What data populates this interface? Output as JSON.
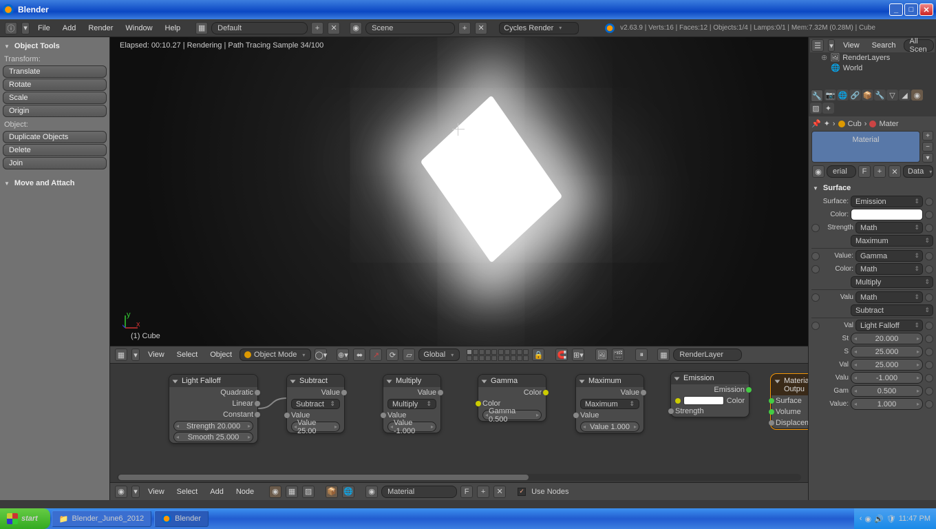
{
  "window": {
    "title": "Blender"
  },
  "top_menu": {
    "items": [
      "File",
      "Add",
      "Render",
      "Window",
      "Help"
    ],
    "layout": "Default",
    "scene": "Scene",
    "engine": "Cycles Render",
    "stats": "v2.63.9 | Verts:16 | Faces:12 | Objects:1/4 | Lamps:0/1 | Mem:7.32M (0.28M) | Cube"
  },
  "left": {
    "panel1": "Object Tools",
    "transform_lbl": "Transform:",
    "transform": [
      "Translate",
      "Rotate",
      "Scale",
      "Origin"
    ],
    "object_lbl": "Object:",
    "object": [
      "Duplicate Objects",
      "Delete",
      "Join"
    ],
    "panel2": "Move and Attach"
  },
  "viewport": {
    "status": "Elapsed: 00:10.27 | Rendering | Path Tracing Sample 34/100",
    "label": "(1) Cube",
    "header": {
      "menus": [
        "View",
        "Select",
        "Object"
      ],
      "mode": "Object Mode",
      "orient": "Global",
      "layer": "RenderLayer"
    }
  },
  "nodes": {
    "falloff": {
      "title": "Light Falloff",
      "out1": "Quadratic",
      "out2": "Linear",
      "out3": "Constant",
      "strength": "Strength 20.000",
      "smooth": "Smooth 25.000"
    },
    "subtract": {
      "title": "Subtract",
      "out": "Value",
      "op": "Subtract",
      "in1": "Value",
      "val": "Value 25.00"
    },
    "multiply": {
      "title": "Multiply",
      "out": "Value",
      "op": "Multiply",
      "in1": "Value",
      "val": "Value -1.000"
    },
    "gamma": {
      "title": "Gamma",
      "out": "Color",
      "in1": "Color",
      "val": "Gamma 0.500"
    },
    "maximum": {
      "title": "Maximum",
      "out": "Value",
      "op": "Maximum",
      "in1": "Value",
      "val": "Value 1.000"
    },
    "emission": {
      "title": "Emission",
      "out": "Emission",
      "in1": "Color",
      "in2": "Strength"
    },
    "output": {
      "title": "Material Outpu",
      "in1": "Surface",
      "in2": "Volume",
      "in3": "Displacement"
    },
    "footer": {
      "menus": [
        "View",
        "Select",
        "Add",
        "Node"
      ],
      "material": "Material",
      "usenodes": "Use Nodes"
    }
  },
  "right": {
    "outliner": {
      "menus": [
        "View",
        "Search"
      ],
      "all": "All Scen",
      "items": [
        "RenderLayers",
        "World"
      ]
    },
    "crumb": {
      "a": "Cub",
      "b": "Mater"
    },
    "slot": "Material",
    "name": "erial",
    "data": "Data",
    "surface_hdr": "Surface",
    "rows": {
      "surface": "Surface:",
      "surface_v": "Emission",
      "color": "Color:",
      "strength": "Strength",
      "strength_v": "Math",
      "strength_op": "Maximum",
      "value": "Value:",
      "value_v": "Gamma",
      "color2": "Color:",
      "color2_v": "Math",
      "color2_op": "Multiply",
      "valu": "Valu",
      "valu_v": "Math",
      "valu_op": "Subtract",
      "val": "Val",
      "val_v": "Light Falloff",
      "st": "St",
      "st_v": "20.000",
      "s": "S",
      "s_v": "25.000",
      "val2": "Val",
      "val2_v": "25.000",
      "valu2": "Valu",
      "valu2_v": "-1.000",
      "gam": "Gam",
      "gam_v": "0.500",
      "value2": "Value:",
      "value2_v": "1.000"
    }
  },
  "taskbar": {
    "start": "start",
    "items": [
      "Blender_June6_2012",
      "Blender"
    ],
    "time": "11:47 PM"
  }
}
